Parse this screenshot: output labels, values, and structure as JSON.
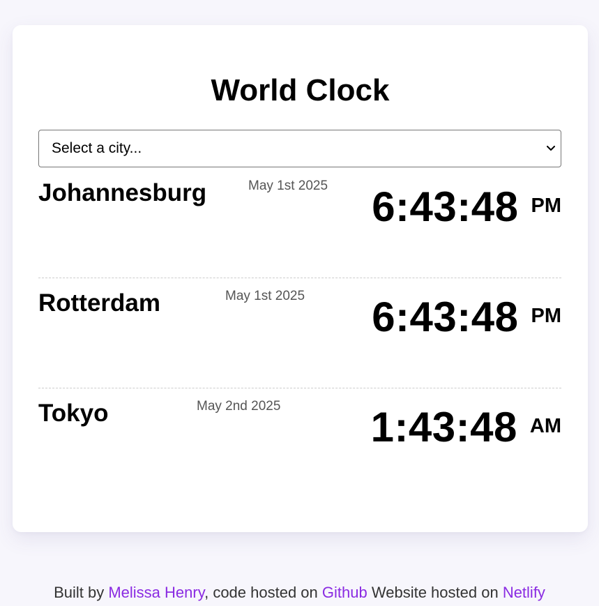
{
  "app": {
    "title": "World Clock"
  },
  "city_select": {
    "selected_value": "Select a city...",
    "icon": "chevron-down-icon"
  },
  "cities": [
    {
      "name": "Johannesburg",
      "date": "May 1st 2025",
      "time": "6:43:48",
      "ampm": "PM"
    },
    {
      "name": "Rotterdam",
      "date": "May 1st 2025",
      "time": "6:43:48",
      "ampm": "PM"
    },
    {
      "name": "Tokyo",
      "date": "May 2nd 2025",
      "time": "1:43:48",
      "ampm": "AM"
    }
  ],
  "footer": {
    "prefix": "Built by",
    "author_link": "Melissa Henry",
    "middle": ", code hosted on",
    "github_link": "Github",
    "website_text": "Website hosted on",
    "netlify_link": "Netlify"
  },
  "colors": {
    "background": "#f7f6fc",
    "card": "#ffffff",
    "link": "#8a2be2",
    "divider": "#cccccc"
  }
}
